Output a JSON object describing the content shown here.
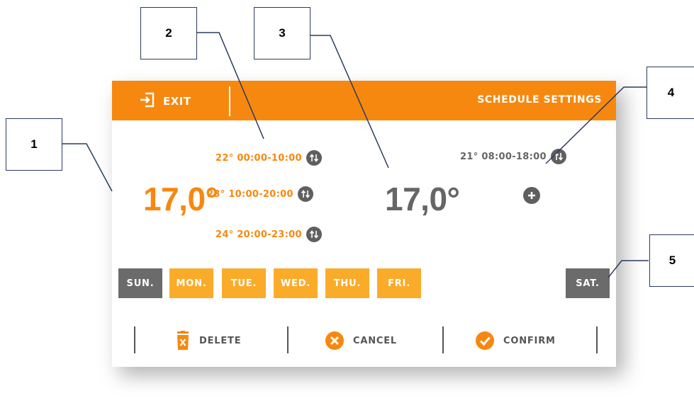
{
  "header": {
    "exit_label": "EXIT",
    "title": "SCHEDULE SETTINGS"
  },
  "left_temperature": "17,0°",
  "right_temperature": "17,0°",
  "left_slots": [
    {
      "temp": "22°",
      "time": "00:00-10:00"
    },
    {
      "temp": "23°",
      "time": "10:00-20:00"
    },
    {
      "temp": "24°",
      "time": "20:00-23:00"
    }
  ],
  "right_slots": [
    {
      "temp": "21°",
      "time": "08:00-18:00"
    }
  ],
  "days": [
    {
      "label": "SUN.",
      "state": "inactive"
    },
    {
      "label": "MON.",
      "state": "active"
    },
    {
      "label": "TUE.",
      "state": "active"
    },
    {
      "label": "WED.",
      "state": "active"
    },
    {
      "label": "THU.",
      "state": "active"
    },
    {
      "label": "FRI.",
      "state": "active"
    },
    {
      "label": "SAT.",
      "state": "inactive"
    }
  ],
  "actions": {
    "delete_label": "DELETE",
    "cancel_label": "CANCEL",
    "confirm_label": "CONFIRM"
  },
  "callouts": [
    "1",
    "2",
    "3",
    "4",
    "5"
  ],
  "colors": {
    "accent": "#f7880f",
    "day_active": "#fbab2a",
    "day_inactive": "#6b6b6b",
    "text_gray": "#666666",
    "callout_border": "#2a3b5c"
  },
  "icons": {
    "exit": "exit-icon",
    "swap": "swap-icon",
    "plus": "plus-icon",
    "delete": "trash-icon",
    "cancel": "cancel-icon",
    "confirm": "check-icon"
  }
}
